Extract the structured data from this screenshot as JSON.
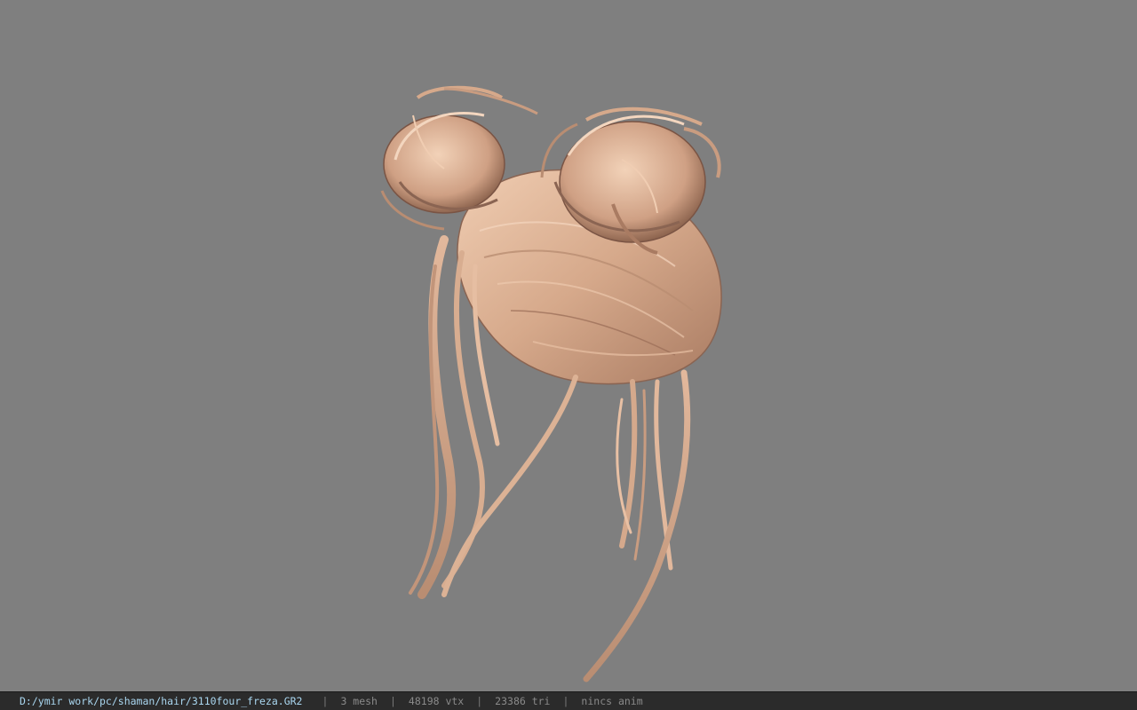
{
  "viewport": {
    "background": "#7f7f7f",
    "hair_colors": {
      "light": "#e8c0a4",
      "mid": "#c99c80",
      "dark": "#8a6452",
      "shadow": "#5e4438"
    }
  },
  "status": {
    "file_path": "D:/ymir work/pc/shaman/hair/3110four_freza.GR2",
    "separator": "|",
    "mesh_count": "3 mesh",
    "vertex_count": "48198 vtx",
    "triangle_count": "23386 tri",
    "anim_status": "nincs anim"
  }
}
